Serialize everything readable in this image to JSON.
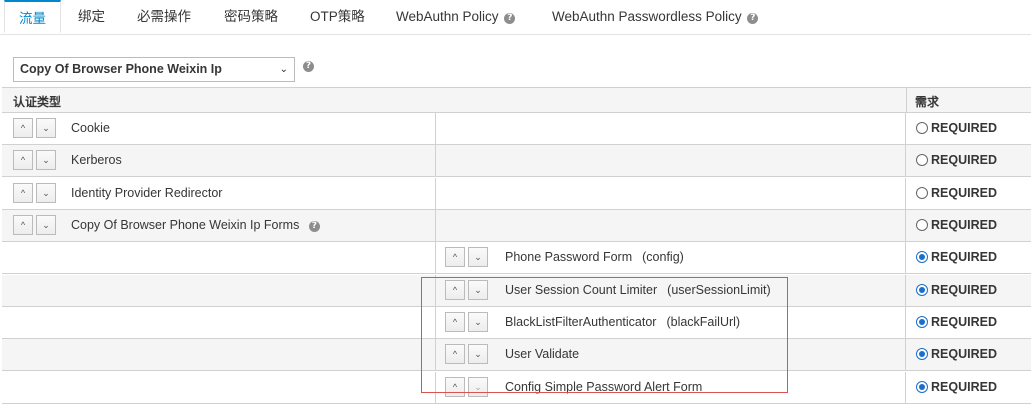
{
  "tabs": [
    {
      "label": "流量",
      "active": true
    },
    {
      "label": "绑定"
    },
    {
      "label": "必需操作"
    },
    {
      "label": "密码策略"
    },
    {
      "label": "OTP策略"
    },
    {
      "label": "WebAuthn Policy",
      "help": true
    },
    {
      "label": "WebAuthn Passwordless Policy",
      "help": true
    }
  ],
  "flow_select": {
    "value": "Copy Of Browser Phone Weixin Ip",
    "caret": "⌄"
  },
  "table": {
    "headers": {
      "auth_type": "认证类型",
      "requirement": "需求"
    },
    "rows": [
      {
        "label": "Cookie",
        "config": "",
        "level": 0,
        "requirement": "REQUIRED",
        "checked": false
      },
      {
        "label": "Kerberos",
        "config": "",
        "level": 0,
        "requirement": "REQUIRED",
        "checked": false
      },
      {
        "label": "Identity Provider Redirector",
        "config": "",
        "level": 0,
        "requirement": "REQUIRED",
        "checked": false
      },
      {
        "label": "Copy Of Browser Phone Weixin Ip Forms",
        "config": "",
        "level": 0,
        "help": true,
        "requirement": "REQUIRED",
        "checked": false
      },
      {
        "label": "Phone Password Form",
        "config": "(config)",
        "level": 1,
        "requirement": "REQUIRED",
        "checked": true
      },
      {
        "label": "User Session Count Limiter",
        "config": "(userSessionLimit)",
        "level": 1,
        "requirement": "REQUIRED",
        "checked": true
      },
      {
        "label": "BlackListFilterAuthenticator",
        "config": "(blackFailUrl)",
        "level": 1,
        "requirement": "REQUIRED",
        "checked": true
      },
      {
        "label": "User Validate",
        "config": "",
        "level": 1,
        "requirement": "REQUIRED",
        "checked": true
      },
      {
        "label": "Config Simple Password Alert Form",
        "config": "",
        "level": 1,
        "requirement": "REQUIRED",
        "checked": true
      }
    ]
  },
  "icons": {
    "up": "^",
    "down": "⌄",
    "help": "?"
  },
  "colors": {
    "accent": "#0088ce",
    "radio_checked": "#1a6ecc",
    "highlight": "#d9534f"
  }
}
